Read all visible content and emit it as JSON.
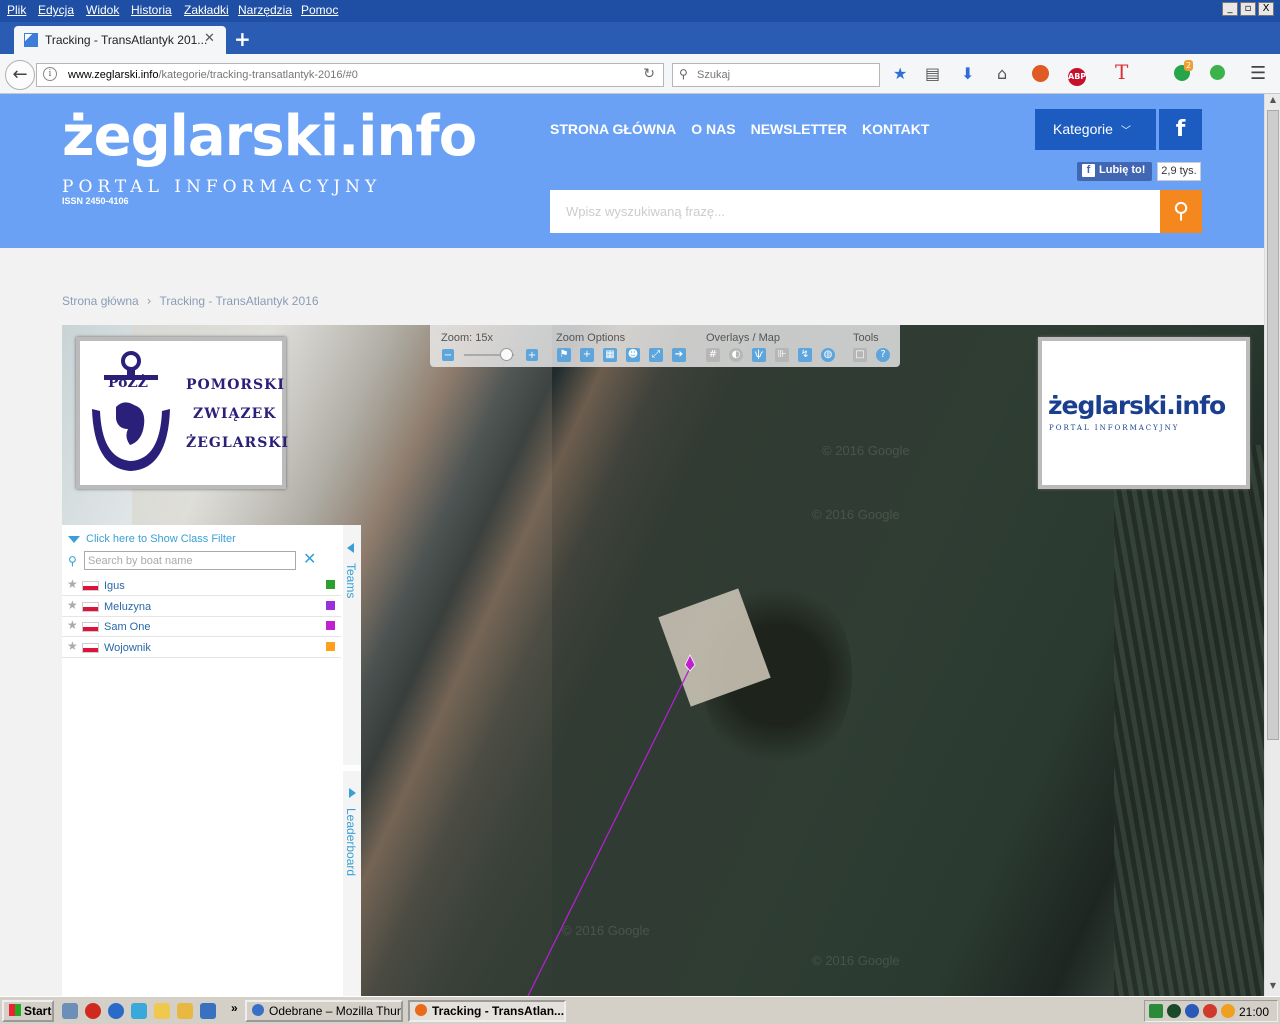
{
  "browser": {
    "menu": [
      "Plik",
      "Edycja",
      "Widok",
      "Historia",
      "Zakładki",
      "Narzędzia",
      "Pomoc"
    ],
    "window_buttons": [
      "_",
      "▫",
      "X"
    ],
    "tab_title": "Tracking - TransAtlantyk 201...",
    "new_tab": "+",
    "url_domain": "www.zeglarski.info",
    "url_path": "/kategorie/tracking-transatlantyk-2016/#0",
    "search_placeholder": "Szukaj",
    "toolbar_badges": {
      "abp": "ABP",
      "t": "T",
      "count": "2"
    }
  },
  "site": {
    "logo": "żeglarski.info",
    "tagline": "PORTAL INFORMACYJNY",
    "issn": "ISSN 2450-4106",
    "nav": [
      "STRONA GŁÓWNA",
      "O NAS",
      "NEWSLETTER",
      "KONTAKT"
    ],
    "categories_button": "Kategorie",
    "fb_icon": "f",
    "fb_like": "Lubię to!",
    "fb_count": "2,9 tys.",
    "search_placeholder": "Wpisz wyszukiwaną frazę..."
  },
  "breadcrumb": [
    "Strona główna",
    "Tracking - TransAtlantyk 2016"
  ],
  "map": {
    "toolbar": {
      "zoom_label": "Zoom: 15x",
      "zoom_level": 15,
      "zoom_options": "Zoom Options",
      "overlays": "Overlays / Map",
      "tools": "Tools"
    },
    "sponsor_left": {
      "mark": "PoZŻ",
      "lines": [
        "POMORSKI",
        "ZWIĄZEK",
        "ŻEGLARSKI"
      ]
    },
    "sponsor_right": {
      "logo": "żeglarski.info",
      "tagline": "PORTAL INFORMACYJNY"
    },
    "watermark": "© 2016 Google"
  },
  "tracking": {
    "class_filter": "Click here to Show Class Filter",
    "search_placeholder": "Search by boat name",
    "boats": [
      {
        "name": "Igus",
        "color": "#2ca02c"
      },
      {
        "name": "Meluzyna",
        "color": "#9b30d9"
      },
      {
        "name": "Sam One",
        "color": "#c020d0"
      },
      {
        "name": "Wojownik",
        "color": "#ff9f1a"
      }
    ],
    "teams_tab": "Teams",
    "leaderboard_tab": "Leaderboard"
  },
  "taskbar": {
    "start": "Start",
    "more": "»",
    "tasks": [
      "Odebrane – Mozilla Thun...",
      "Tracking - TransAtlan..."
    ],
    "clock": "21:00"
  }
}
